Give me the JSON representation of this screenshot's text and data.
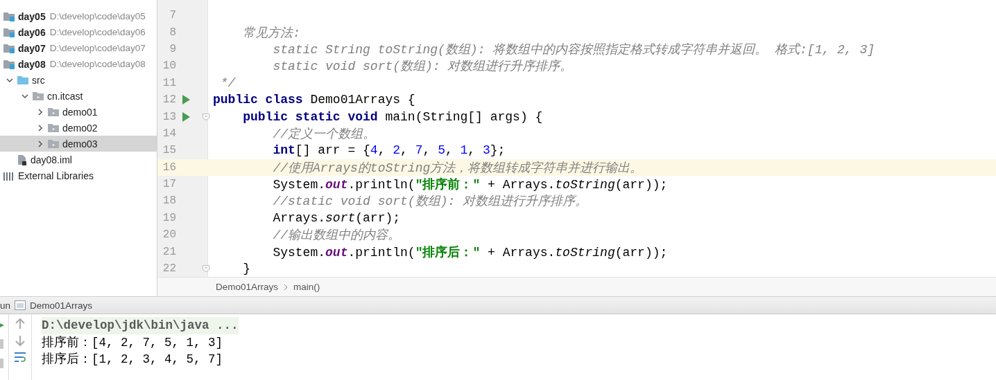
{
  "project_tree": [
    {
      "kind": "module",
      "name": "day05",
      "path": "D:\\develop\\code\\day05",
      "selected": false
    },
    {
      "kind": "module",
      "name": "day06",
      "path": "D:\\develop\\code\\day06",
      "selected": false
    },
    {
      "kind": "module",
      "name": "day07",
      "path": "D:\\develop\\code\\day07",
      "selected": false
    },
    {
      "kind": "module",
      "name": "day08",
      "path": "D:\\develop\\code\\day08",
      "selected": false,
      "children": [
        {
          "kind": "source_folder",
          "name": "src",
          "expanded": true,
          "selected": false,
          "children": [
            {
              "kind": "package",
              "name": "cn.itcast",
              "expanded": true,
              "selected": false,
              "children": [
                {
                  "kind": "package",
                  "name": "demo01",
                  "expanded": false,
                  "selected": false
                },
                {
                  "kind": "package",
                  "name": "demo02",
                  "expanded": false,
                  "selected": false
                },
                {
                  "kind": "package",
                  "name": "demo03",
                  "expanded": false,
                  "selected": true
                }
              ]
            }
          ]
        },
        {
          "kind": "file",
          "name": "day08.iml",
          "selected": false
        }
      ]
    },
    {
      "kind": "library",
      "name": "External Libraries",
      "selected": false
    }
  ],
  "editor": {
    "lines": [
      {
        "number": "7",
        "current": false
      },
      {
        "number": "8",
        "current": false,
        "tokens": [
          {
            "kind": "comment",
            "text": "    常见方法:"
          }
        ]
      },
      {
        "number": "9",
        "current": false,
        "tokens": [
          {
            "kind": "comment",
            "text": "        static String toString(数组): 将数组中的内容按照指定格式转成字符串并返回。 格式:[1, 2, 3]"
          }
        ]
      },
      {
        "number": "10",
        "current": false,
        "tokens": [
          {
            "kind": "comment",
            "text": "        static void sort(数组): 对数组进行升序排序。"
          }
        ]
      },
      {
        "number": "11",
        "current": false,
        "tokens": [
          {
            "kind": "comment",
            "text": " */"
          }
        ]
      },
      {
        "number": "12",
        "current": false,
        "run": true,
        "tokens": [
          {
            "kind": "keyword",
            "text": "public class "
          },
          {
            "kind": "plain",
            "text": "Demo01Arrays {"
          }
        ]
      },
      {
        "number": "13",
        "current": false,
        "run": true,
        "fold": true,
        "tokens": [
          {
            "kind": "keyword",
            "text": "    public static void "
          },
          {
            "kind": "plain",
            "text": "main(String[] args) {"
          }
        ]
      },
      {
        "number": "14",
        "current": false,
        "tokens": [
          {
            "kind": "comment",
            "text": "        //定义一个数组。"
          }
        ]
      },
      {
        "number": "15",
        "current": false,
        "tokens": [
          {
            "kind": "keyword",
            "text": "        int"
          },
          {
            "kind": "plain",
            "text": "[] arr = {"
          },
          {
            "kind": "number",
            "text": "4"
          },
          {
            "kind": "plain",
            "text": ", "
          },
          {
            "kind": "number",
            "text": "2"
          },
          {
            "kind": "plain",
            "text": ", "
          },
          {
            "kind": "number",
            "text": "7"
          },
          {
            "kind": "plain",
            "text": ", "
          },
          {
            "kind": "number",
            "text": "5"
          },
          {
            "kind": "plain",
            "text": ", "
          },
          {
            "kind": "number",
            "text": "1"
          },
          {
            "kind": "plain",
            "text": ", "
          },
          {
            "kind": "number",
            "text": "3"
          },
          {
            "kind": "plain",
            "text": "};"
          }
        ]
      },
      {
        "number": "16",
        "current": true,
        "tokens": [
          {
            "kind": "comment",
            "text": "        //使用Arrays的toString方法，将数组转成字符串并进行输出。"
          }
        ]
      },
      {
        "number": "17",
        "current": false,
        "tokens": [
          {
            "kind": "plain",
            "text": "        System."
          },
          {
            "kind": "field",
            "text": "out"
          },
          {
            "kind": "plain",
            "text": ".println("
          },
          {
            "kind": "string",
            "text": "\"排序前：\""
          },
          {
            "kind": "plain",
            "text": " + Arrays."
          },
          {
            "kind": "method",
            "text": "toString"
          },
          {
            "kind": "plain",
            "text": "(arr));"
          }
        ]
      },
      {
        "number": "18",
        "current": false,
        "tokens": [
          {
            "kind": "comment",
            "text": "        //static void sort(数组): 对数组进行升序排序。"
          }
        ]
      },
      {
        "number": "19",
        "current": false,
        "tokens": [
          {
            "kind": "plain",
            "text": "        Arrays."
          },
          {
            "kind": "method",
            "text": "sort"
          },
          {
            "kind": "plain",
            "text": "(arr);"
          }
        ]
      },
      {
        "number": "20",
        "current": false,
        "tokens": [
          {
            "kind": "comment",
            "text": "        //输出数组中的内容。"
          }
        ]
      },
      {
        "number": "21",
        "current": false,
        "tokens": [
          {
            "kind": "plain",
            "text": "        System."
          },
          {
            "kind": "field",
            "text": "out"
          },
          {
            "kind": "plain",
            "text": ".println("
          },
          {
            "kind": "string",
            "text": "\"排序后：\""
          },
          {
            "kind": "plain",
            "text": " + Arrays."
          },
          {
            "kind": "method",
            "text": "toString"
          },
          {
            "kind": "plain",
            "text": "(arr));"
          }
        ]
      },
      {
        "number": "22",
        "current": false,
        "fold": true,
        "tokens": [
          {
            "kind": "plain",
            "text": "    }"
          }
        ]
      }
    ],
    "breadcrumbs": [
      "Demo01Arrays",
      "main()"
    ]
  },
  "run_panel": {
    "label": "un",
    "tab": "Demo01Arrays",
    "console": [
      {
        "kind": "command",
        "text": "D:\\develop\\jdk\\bin\\java ..."
      },
      {
        "kind": "output",
        "text": "排序前：[4, 2, 7, 5, 1, 3]"
      },
      {
        "kind": "output",
        "text": "排序后：[1, 2, 3, 4, 5, 7]"
      }
    ]
  }
}
